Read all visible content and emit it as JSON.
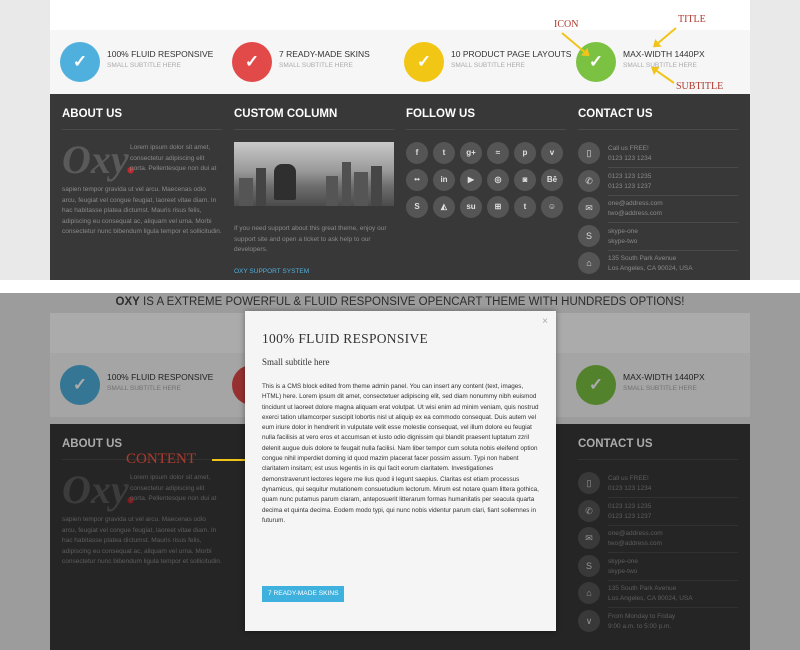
{
  "colors": {
    "blue": "#4fb0dd",
    "red": "#e24a4a",
    "yellow": "#f2c614",
    "green": "#7cc242",
    "footer_bg": "#383838",
    "accent": "#3fb1de",
    "annotation": "#b03a2e",
    "arrow": "#f0c418"
  },
  "features": [
    {
      "title": "100% FLUID RESPONSIVE",
      "subtitle": "SMALL SUBTITLE HERE",
      "icon": "check-icon",
      "color": "#4fb0dd"
    },
    {
      "title": "7 READY-MADE SKINS",
      "subtitle": "SMALL SUBTITLE HERE",
      "icon": "check-icon",
      "color": "#e24a4a"
    },
    {
      "title": "10 PRODUCT PAGE LAYOUTS",
      "subtitle": "SMALL SUBTITLE HERE",
      "icon": "check-icon",
      "color": "#f2c614"
    },
    {
      "title": "MAX-WIDTH 1440PX",
      "subtitle": "SMALL SUBTITLE HERE",
      "icon": "check-icon",
      "color": "#7cc242"
    }
  ],
  "annotations": {
    "icon": "ICON",
    "title": "TITLE",
    "subtitle": "SUBTITLE",
    "content": "CONTENT"
  },
  "footer": {
    "about": {
      "heading": "ABOUT US",
      "logo_text": "Oxy",
      "logo_dot": ".",
      "text_right": "Lorem ipsum dolor sit amet, consectetur adipiscing elit porta. Pellentesque non dui at",
      "text_full": "sapien tempor gravida ut vel arcu. Maecenas odio arcu, feugiat vel congue feugiat, laoreet vitae diam. In hac habitasse platea dictumst. Mauris risus felis, adipiscing eu consequat ac, aliquam vel urna. Morbi consectetur nunc bibendum ligula tempor et sollicitudin."
    },
    "custom": {
      "heading": "CUSTOM COLUMN",
      "text": "If you need support about this great theme, enjoy our support site and open a ticket to ask help to our developers.",
      "link": "OXY SUPPORT SYSTEM"
    },
    "follow": {
      "heading": "FOLLOW US",
      "icons": [
        {
          "name": "facebook-icon",
          "glyph": "f"
        },
        {
          "name": "twitter-icon",
          "glyph": "t"
        },
        {
          "name": "google-plus-icon",
          "glyph": "g+"
        },
        {
          "name": "rss-icon",
          "glyph": "≈"
        },
        {
          "name": "pinterest-icon",
          "glyph": "p"
        },
        {
          "name": "vimeo-icon",
          "glyph": "v"
        },
        {
          "name": "flickr-icon",
          "glyph": "••"
        },
        {
          "name": "linkedin-icon",
          "glyph": "in"
        },
        {
          "name": "youtube-icon",
          "glyph": "▶"
        },
        {
          "name": "dribbble-icon",
          "glyph": "◎"
        },
        {
          "name": "instagram-icon",
          "glyph": "◙"
        },
        {
          "name": "behance-icon",
          "glyph": "Bē"
        },
        {
          "name": "skype-icon",
          "glyph": "S"
        },
        {
          "name": "delicious-icon",
          "glyph": "◭"
        },
        {
          "name": "stumbleupon-icon",
          "glyph": "su"
        },
        {
          "name": "windows-icon",
          "glyph": "⊞"
        },
        {
          "name": "tumblr-icon",
          "glyph": "t"
        },
        {
          "name": "reddit-icon",
          "glyph": "☺"
        }
      ]
    },
    "contact": {
      "heading": "CONTACT US",
      "items": [
        {
          "icon": "mobile-icon",
          "glyph": "▯",
          "lines": [
            "Call us FREE!",
            "0123 123 1234"
          ]
        },
        {
          "icon": "phone-icon",
          "glyph": "✆",
          "lines": [
            "0123 123 1235",
            "0123 123 1237"
          ]
        },
        {
          "icon": "email-icon",
          "glyph": "✉",
          "lines": [
            "one@address.com",
            "two@address.com"
          ]
        },
        {
          "icon": "skype-icon",
          "glyph": "S",
          "lines": [
            "skype-one",
            "skype-two"
          ]
        },
        {
          "icon": "home-icon",
          "glyph": "⌂",
          "lines": [
            "135 South Park Avenue",
            "Los Angeles, CA 90024, USA"
          ]
        },
        {
          "icon": "clock-icon",
          "glyph": "∨",
          "lines": [
            "From Monday to Friday",
            "9:00 a.m. to 5:00 p.m."
          ]
        }
      ]
    }
  },
  "tagline": {
    "bold": "OXY",
    "rest": " IS A EXTREME POWERFUL & FLUID RESPONSIVE OPENCART THEME WITH HUNDREDS OPTIONS!"
  },
  "modal": {
    "title": "100% FLUID RESPONSIVE",
    "subtitle": "Small subtitle here",
    "close": "×",
    "body": "This is a CMS block edited from theme admin panel. You can insert any content (text, images, HTML) here. Lorem ipsum dit amet, consectetuer adipiscing elit, sed diam nonummy nibh euismod tincidunt ut laoreet dolore magna aliquam erat volutpat. Ut wisi enim ad minim veniam, quis nostrud exerci tation ullamcorper suscipit lobortis nisl ut aliquip ex ea commodo consequat. Duis autem vel eum iriure dolor in hendrerit in vulputate velit esse molestie consequat, vel illum dolore eu feugiat nulla facilisis at vero eros et accumsan et iusto odio dignissim qui blandit praesent luptatum zzril delenit augue duis dolore te feugait nulla facilisi. Nam liber tempor cum soluta nobis eleifend option congue nihil imperdiet doming id quod mazim placerat facer possim assum. Typi non habent claritatem insitam; est usus legentis in iis qui facit eorum claritatem. Investigationes demonstraverunt lectores legere me lius quod ii legunt saepius. Claritas est etiam processus dynamicus, qui sequitur mutationem consuetudium lectorum. Mirum est notare quam littera gothica, quam nunc putamus parum claram, anteposuerit litterarum formas humanitatis per seacula quarta decima et quinta decima. Eodem modo typi, qui nunc nobis videntur parum clari, fiant sollemnes in futurum.",
    "button": "7 READY-MADE SKINS"
  }
}
